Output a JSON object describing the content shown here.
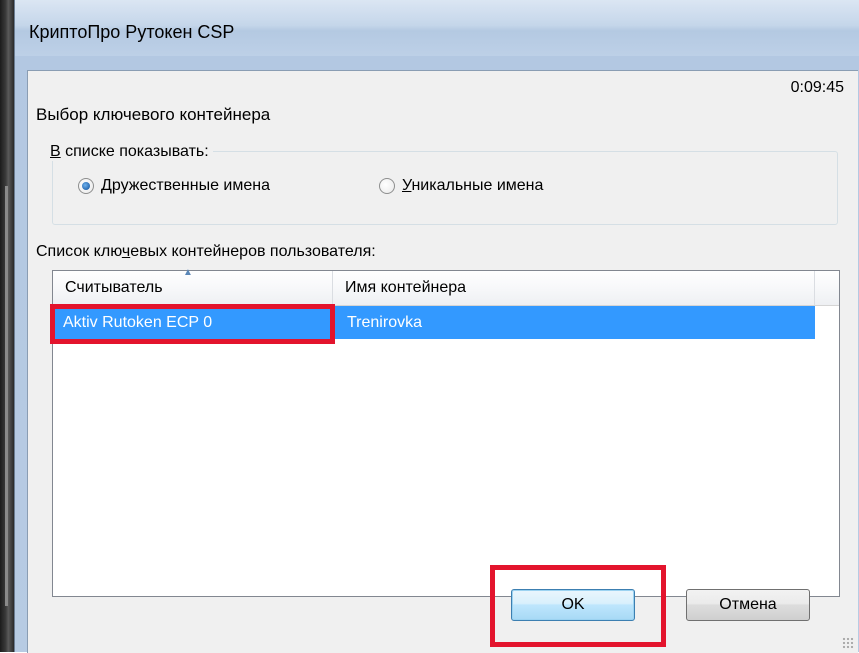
{
  "window": {
    "title": "КриптоПро Рутокен CSP"
  },
  "timer": "0:09:45",
  "heading": "Выбор ключевого контейнера",
  "display_group": {
    "legend_prefix": "В",
    "legend_rest": " списке показывать:",
    "options": [
      {
        "prefix": "Д",
        "rest": "ружественные имена",
        "selected": true
      },
      {
        "prefix": "У",
        "rest": "никальные имена",
        "selected": false
      }
    ]
  },
  "list_label": {
    "before": "Список клю",
    "accel": "ч",
    "after": "евых контейнеров пользователя:"
  },
  "listview": {
    "columns": [
      "Считыватель",
      "Имя контейнера"
    ],
    "sort_indicator": "▲",
    "rows": [
      {
        "reader": "Aktiv Rutoken ECP 0",
        "container": "Trenirovka",
        "selected": true
      }
    ]
  },
  "buttons": {
    "ok": "OK",
    "cancel": "Отмена"
  },
  "colors": {
    "selection": "#3399ff",
    "annotation_red": "#e3142d"
  }
}
